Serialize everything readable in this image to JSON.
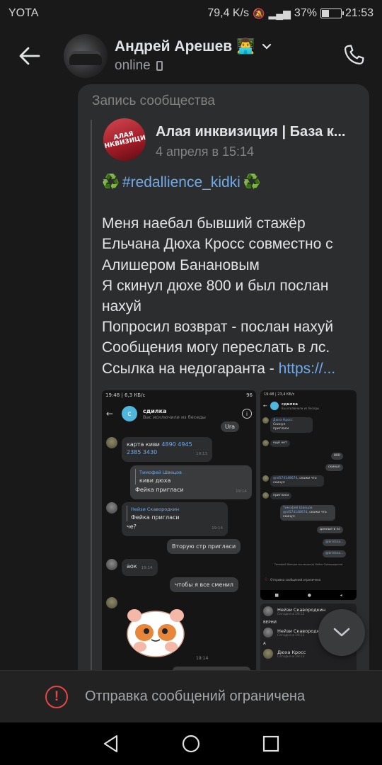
{
  "status_bar": {
    "carrier": "YOTA",
    "speed": "79,4 K/s",
    "battery_percent": "37%",
    "battery_level": 0.37,
    "time": "21:53"
  },
  "header": {
    "contact_name": "Андрей Арешев",
    "name_emoji": "👨‍💻",
    "status": "online",
    "icons": [
      "back-arrow-icon",
      "chevron-down-icon",
      "mobile-icon",
      "phone-call-icon"
    ]
  },
  "message": {
    "repost_label": "Запись сообщества",
    "community_name": "Алая инквизиция | База к...",
    "community_avatar_text": "АЛАЯ ИНКВИЗИЦИЯ",
    "post_date": "4 апреля в 15:14",
    "hashtag": "#redallience_kidki",
    "text_lines": [
      "Меня наебал бывший стажёр",
      "Ельчана Дюха Кросс совместно с",
      "Алишером Банановым",
      "Я скинул дюхе 800 и был послан",
      "нахуй",
      "Попросил возврат - послан нахуй",
      "Сообщения могу переслать в лс.",
      "Ссылка на недогаранта - "
    ],
    "link_text": "https://..."
  },
  "screenshot1": {
    "time": "19:48 | 6,3 КБ/с",
    "battery": "96",
    "chat_title": "сдилка",
    "chat_avatar_letter": "с",
    "chat_subtitle": "Вас исключили из беседы",
    "msgs": {
      "ura": "Ura",
      "kiwi_label": "карта киви ",
      "kiwi_number": "4890 4945 2385 3430",
      "kiwi_time": "19:13",
      "reply1_author": "Тимофей Швецов",
      "reply1_quote": "киви дюха",
      "reply1_text": "Фейка пригласи",
      "reply1_time": "19:14",
      "reply2_author": "Нейзи Скавородкин",
      "reply2_quote": "Фейка пригласи",
      "reply2_text": "че?",
      "reply2_time": "19:14",
      "out1": "Вторую стр пригласи",
      "aok": "аок",
      "aok_time": "19:14",
      "out2": "чтобы я все сменил",
      "sticker_time": "19:14"
    }
  },
  "screenshot2": {
    "time": "19:48 | 23,4 КБ/с",
    "title": "сдилка",
    "subtitle": "Вы исключили из беседы",
    "lines": {
      "a1_author": "Дюха Кросс",
      "a1_text": "Скинул",
      "a1_text2": "пригласи",
      "a2": "ещё нет",
      "o1": "800",
      "o2": "скинул",
      "a3_link": "@id574148674",
      "a3_text": ", скажи что скинул",
      "a4": "пригласи",
      "q_author": "Тимофей Швецов",
      "q_link": "@id574148674",
      "q_text": ", скажи что скинул",
      "o3": "данные в лс",
      "o4": "@kristinа...",
      "o5": "@kristinа...",
      "sys": "Тимофей Швецов исключил(а) Нейзи Скавородкина",
      "limit": "Отправка сообщений ограничена"
    }
  },
  "screenshot3": {
    "rows": [
      {
        "name": "Нейзи Скавородкин",
        "meta": "Сегодня в 19:12"
      },
      {
        "text": "ВЕРНИ"
      },
      {
        "name": "Нейзи Скавородкин",
        "meta": "Сегодня в 19:13"
      },
      {
        "text": "А"
      },
      {
        "name": "Дюха Кросс",
        "meta": "Сегодня в 19:13"
      }
    ]
  },
  "notice": {
    "text": "Отправка сообщений ограничена",
    "icon": "alert-circle-icon"
  },
  "colors": {
    "background": "#191919",
    "bubble": "#2c2d2e",
    "link": "#71aaeb",
    "alert": "#e64646"
  }
}
